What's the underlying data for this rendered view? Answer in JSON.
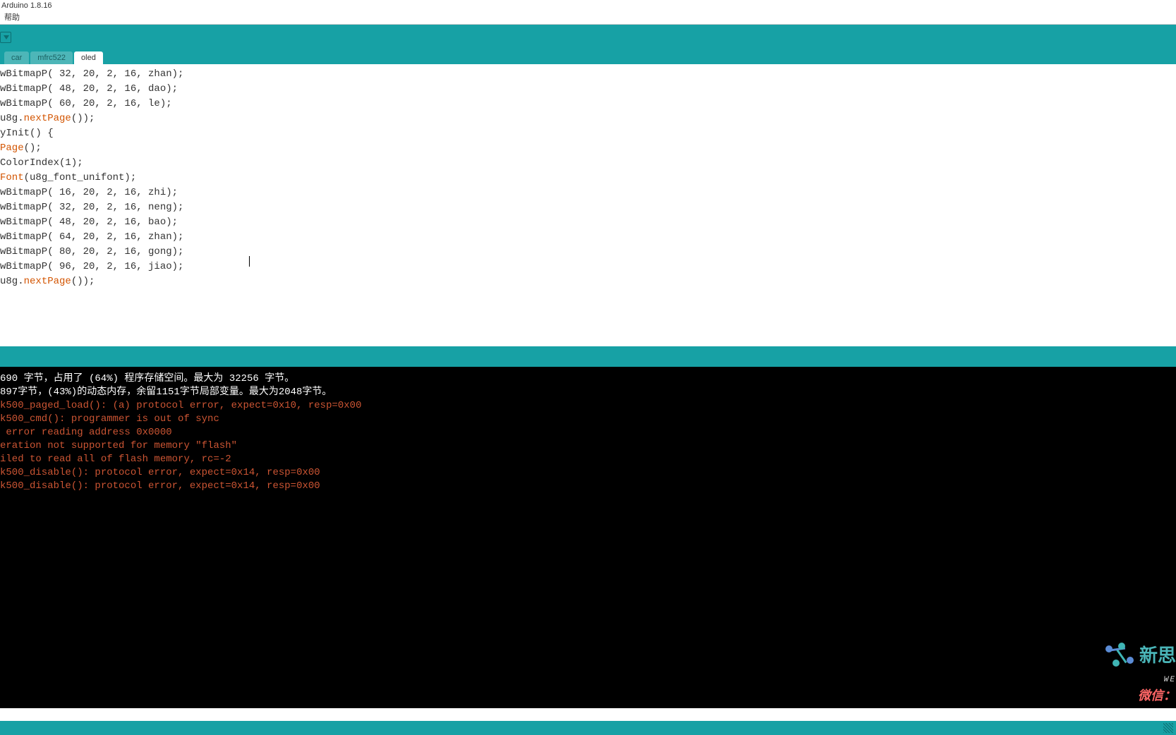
{
  "window": {
    "title": "Arduino 1.8.16"
  },
  "menu": {
    "help": "帮助"
  },
  "tabs": [
    {
      "label": "car",
      "active": false
    },
    {
      "label": "mfrc522",
      "active": false
    },
    {
      "label": "oled",
      "active": true
    }
  ],
  "code": {
    "l1a": "wBitmapP( 32, 20, 2, 16, zhan);",
    "l2a": "wBitmapP( 48, 20, 2, 16, dao);",
    "l3a": "wBitmapP( 60, 20, 2, 16, le);",
    "l4pre": "u8g.",
    "l4fn": "nextPage",
    "l4post": "());",
    "l5": "",
    "l6": "",
    "l7": "yInit() {",
    "l8fn": "Page",
    "l8post": "();",
    "l9": "",
    "l10": "ColorIndex(1);",
    "l11fn": "Font",
    "l11post": "(u8g_font_unifont);",
    "l12": "wBitmapP( 16, 20, 2, 16, zhi);",
    "l13": "wBitmapP( 32, 20, 2, 16, neng);",
    "l14": "wBitmapP( 48, 20, 2, 16, bao);",
    "l15": "wBitmapP( 64, 20, 2, 16, zhan);",
    "l16": "wBitmapP( 80, 20, 2, 16, gong);",
    "l17": "wBitmapP( 96, 20, 2, 16, jiao);",
    "l18pre": "u8g.",
    "l18fn": "nextPage",
    "l18post": "());"
  },
  "console": {
    "l1": "690 字节，占用了 (64%) 程序存储空间。最大为 32256 字节。",
    "l2": "897字节，(43%)的动态内存，余留1151字节局部变量。最大为2048字节。",
    "l3": "",
    "l4": "k500_paged_load(): (a) protocol error, expect=0x10, resp=0x00",
    "l5": "k500_cmd(): programmer is out of sync",
    "l6": " error reading address 0x0000",
    "l7": "eration not supported for memory \"flash\"",
    "l8": "iled to read all of flash memory, rc=-2",
    "l9": "k500_disable(): protocol error, expect=0x14, resp=0x00",
    "l10": "k500_disable(): protocol error, expect=0x14, resp=0x00"
  },
  "watermark": {
    "brand": "新思",
    "sub": "WE",
    "wx": "微信："
  }
}
